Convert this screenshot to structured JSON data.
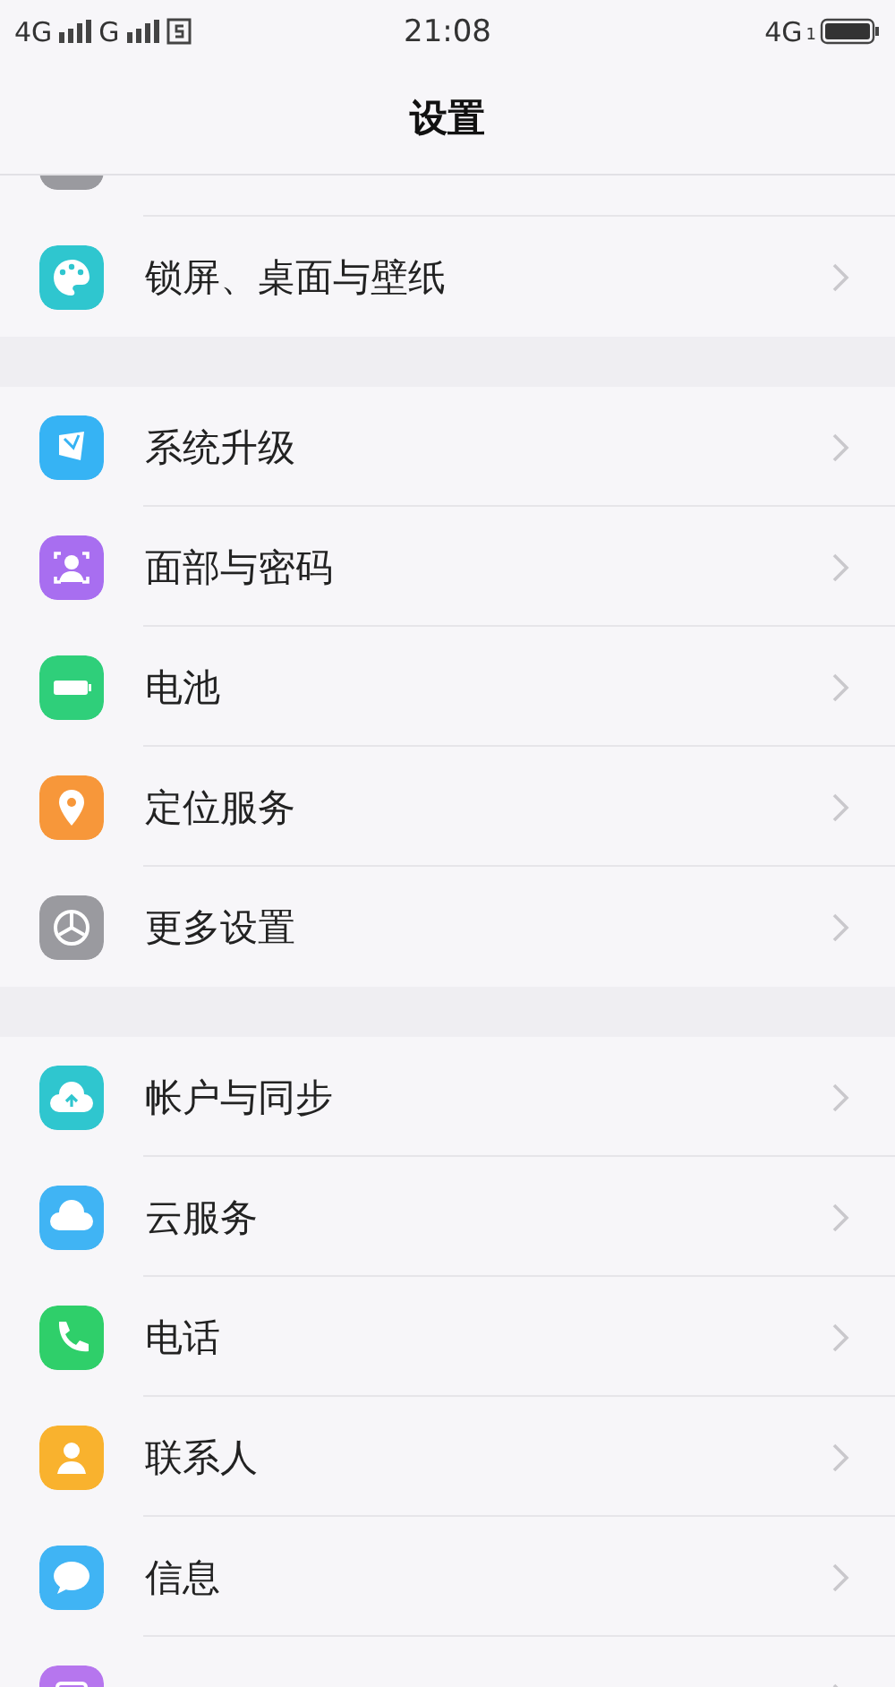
{
  "status_bar": {
    "network_1": "4G",
    "network_2": "G",
    "time": "21:08",
    "network_right": "4G",
    "sim_index": "1"
  },
  "title": "设置",
  "sections": [
    {
      "clipped_top_item": {
        "color": "#9a9a9f"
      },
      "items": [
        {
          "label": "锁屏、桌面与壁纸",
          "kind": "palette",
          "color": "#2fc6cf"
        }
      ]
    },
    {
      "items": [
        {
          "label": "系统升级",
          "kind": "upgrade",
          "color": "#36b3f4"
        },
        {
          "label": "面部与密码",
          "kind": "face",
          "color": "#a86ef0"
        },
        {
          "label": "电池",
          "kind": "battery",
          "color": "#2fcf7a"
        },
        {
          "label": "定位服务",
          "kind": "location",
          "color": "#f7973a"
        },
        {
          "label": "更多设置",
          "kind": "gear",
          "color": "#9a9a9f"
        }
      ]
    },
    {
      "items": [
        {
          "label": "帐户与同步",
          "kind": "account",
          "color": "#2fc6cf"
        },
        {
          "label": "云服务",
          "kind": "cloud",
          "color": "#40b4f4"
        },
        {
          "label": "电话",
          "kind": "phone",
          "color": "#2fcf6a"
        },
        {
          "label": "联系人",
          "kind": "contact",
          "color": "#f9b22e"
        },
        {
          "label": "信息",
          "kind": "message",
          "color": "#40b4f4"
        }
      ],
      "clipped_bottom_item": {
        "kind": "album",
        "color": "#b676ee"
      }
    }
  ]
}
